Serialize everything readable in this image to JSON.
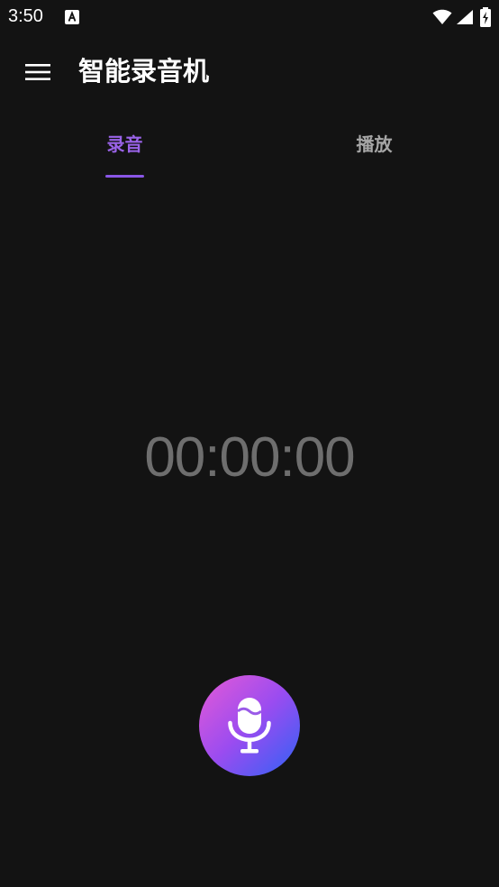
{
  "status_bar": {
    "time": "3:50",
    "icons": [
      "notification-a-icon",
      "wifi-icon",
      "signal-icon",
      "battery-icon"
    ]
  },
  "app_bar": {
    "menu_icon": "hamburger-menu-icon",
    "title": "智能录音机"
  },
  "tabs": [
    {
      "label": "录音",
      "selected": true
    },
    {
      "label": "播放",
      "selected": false
    }
  ],
  "recorder": {
    "timer": "00:00:00",
    "button_icon": "microphone-icon"
  },
  "colors": {
    "background": "#131313",
    "accent": "#8a56e6",
    "tab_inactive": "#a6a6a6",
    "timer": "#6e6e6e",
    "button_gradient": [
      "#e65ad6",
      "#9a4cf0",
      "#2f62f5"
    ]
  }
}
